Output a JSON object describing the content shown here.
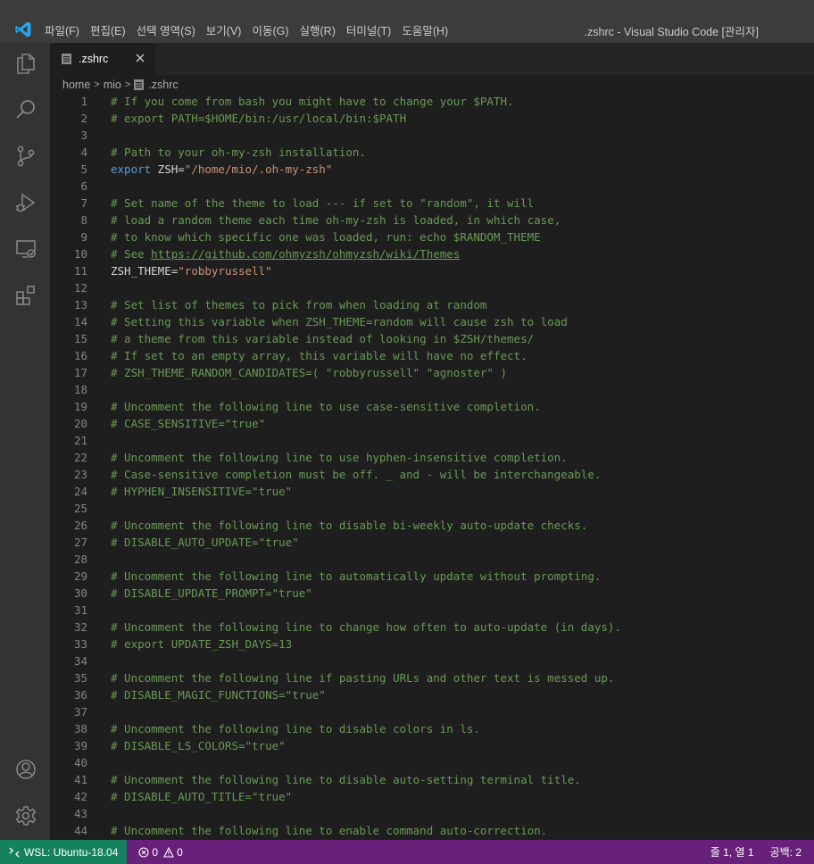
{
  "window": {
    "title": ".zshrc - Visual Studio Code [관리자]"
  },
  "menu": [
    {
      "label": "파일(F)"
    },
    {
      "label": "편집(E)"
    },
    {
      "label": "선택 영역(S)"
    },
    {
      "label": "보기(V)"
    },
    {
      "label": "이동(G)"
    },
    {
      "label": "실행(R)"
    },
    {
      "label": "터미널(T)"
    },
    {
      "label": "도움말(H)"
    }
  ],
  "activity_bar": {
    "icons": [
      "files-icon",
      "search-icon",
      "source-control-icon",
      "run-debug-icon",
      "remote-explorer-icon",
      "extensions-icon",
      "account-icon",
      "settings-gear-icon"
    ]
  },
  "tab": {
    "label": ".zshrc",
    "close_icon": "close-icon"
  },
  "breadcrumb": [
    "home",
    "mio",
    ".zshrc"
  ],
  "editor": {
    "lines": [
      {
        "n": "1",
        "parts": [
          {
            "t": "cm",
            "v": "# If you come from bash you might have to change your $PATH."
          }
        ]
      },
      {
        "n": "2",
        "parts": [
          {
            "t": "cm",
            "v": "# export PATH=$HOME/bin:/usr/local/bin:$PATH"
          }
        ]
      },
      {
        "n": "3",
        "parts": []
      },
      {
        "n": "4",
        "parts": [
          {
            "t": "cm",
            "v": "# Path to your oh-my-zsh installation."
          }
        ]
      },
      {
        "n": "5",
        "parts": [
          {
            "t": "kw",
            "v": "export"
          },
          {
            "t": "plain",
            "v": " ZSH="
          },
          {
            "t": "str",
            "v": "\"/home/mio/.oh-my-zsh\""
          }
        ]
      },
      {
        "n": "6",
        "parts": []
      },
      {
        "n": "7",
        "parts": [
          {
            "t": "cm",
            "v": "# Set name of the theme to load --- if set to \"random\", it will"
          }
        ]
      },
      {
        "n": "8",
        "parts": [
          {
            "t": "cm",
            "v": "# load a random theme each time oh-my-zsh is loaded, in which case,"
          }
        ]
      },
      {
        "n": "9",
        "parts": [
          {
            "t": "cm",
            "v": "# to know which specific one was loaded, run: echo $RANDOM_THEME"
          }
        ]
      },
      {
        "n": "10",
        "parts": [
          {
            "t": "cm",
            "v": "# See "
          },
          {
            "t": "cm link",
            "v": "https://github.com/ohmyzsh/ohmyzsh/wiki/Themes"
          }
        ]
      },
      {
        "n": "11",
        "parts": [
          {
            "t": "plain",
            "v": "ZSH_THEME="
          },
          {
            "t": "str",
            "v": "\"robbyrussell\""
          }
        ]
      },
      {
        "n": "12",
        "parts": []
      },
      {
        "n": "13",
        "parts": [
          {
            "t": "cm",
            "v": "# Set list of themes to pick from when loading at random"
          }
        ]
      },
      {
        "n": "14",
        "parts": [
          {
            "t": "cm",
            "v": "# Setting this variable when ZSH_THEME=random will cause zsh to load"
          }
        ]
      },
      {
        "n": "15",
        "parts": [
          {
            "t": "cm",
            "v": "# a theme from this variable instead of looking in $ZSH/themes/"
          }
        ]
      },
      {
        "n": "16",
        "parts": [
          {
            "t": "cm",
            "v": "# If set to an empty array, this variable will have no effect."
          }
        ]
      },
      {
        "n": "17",
        "parts": [
          {
            "t": "cm",
            "v": "# ZSH_THEME_RANDOM_CANDIDATES=( \"robbyrussell\" \"agnoster\" )"
          }
        ]
      },
      {
        "n": "18",
        "parts": []
      },
      {
        "n": "19",
        "parts": [
          {
            "t": "cm",
            "v": "# Uncomment the following line to use case-sensitive completion."
          }
        ]
      },
      {
        "n": "20",
        "parts": [
          {
            "t": "cm",
            "v": "# CASE_SENSITIVE=\"true\""
          }
        ]
      },
      {
        "n": "21",
        "parts": []
      },
      {
        "n": "22",
        "parts": [
          {
            "t": "cm",
            "v": "# Uncomment the following line to use hyphen-insensitive completion."
          }
        ]
      },
      {
        "n": "23",
        "parts": [
          {
            "t": "cm",
            "v": "# Case-sensitive completion must be off. _ and - will be interchangeable."
          }
        ]
      },
      {
        "n": "24",
        "parts": [
          {
            "t": "cm",
            "v": "# HYPHEN_INSENSITIVE=\"true\""
          }
        ]
      },
      {
        "n": "25",
        "parts": []
      },
      {
        "n": "26",
        "parts": [
          {
            "t": "cm",
            "v": "# Uncomment the following line to disable bi-weekly auto-update checks."
          }
        ]
      },
      {
        "n": "27",
        "parts": [
          {
            "t": "cm",
            "v": "# DISABLE_AUTO_UPDATE=\"true\""
          }
        ]
      },
      {
        "n": "28",
        "parts": []
      },
      {
        "n": "29",
        "parts": [
          {
            "t": "cm",
            "v": "# Uncomment the following line to automatically update without prompting."
          }
        ]
      },
      {
        "n": "30",
        "parts": [
          {
            "t": "cm",
            "v": "# DISABLE_UPDATE_PROMPT=\"true\""
          }
        ]
      },
      {
        "n": "31",
        "parts": []
      },
      {
        "n": "32",
        "parts": [
          {
            "t": "cm",
            "v": "# Uncomment the following line to change how often to auto-update (in days)."
          }
        ]
      },
      {
        "n": "33",
        "parts": [
          {
            "t": "cm",
            "v": "# export UPDATE_ZSH_DAYS=13"
          }
        ]
      },
      {
        "n": "34",
        "parts": []
      },
      {
        "n": "35",
        "parts": [
          {
            "t": "cm",
            "v": "# Uncomment the following line if pasting URLs and other text is messed up."
          }
        ]
      },
      {
        "n": "36",
        "parts": [
          {
            "t": "cm",
            "v": "# DISABLE_MAGIC_FUNCTIONS=\"true\""
          }
        ]
      },
      {
        "n": "37",
        "parts": []
      },
      {
        "n": "38",
        "parts": [
          {
            "t": "cm",
            "v": "# Uncomment the following line to disable colors in ls."
          }
        ]
      },
      {
        "n": "39",
        "parts": [
          {
            "t": "cm",
            "v": "# DISABLE_LS_COLORS=\"true\""
          }
        ]
      },
      {
        "n": "40",
        "parts": []
      },
      {
        "n": "41",
        "parts": [
          {
            "t": "cm",
            "v": "# Uncomment the following line to disable auto-setting terminal title."
          }
        ]
      },
      {
        "n": "42",
        "parts": [
          {
            "t": "cm",
            "v": "# DISABLE_AUTO_TITLE=\"true\""
          }
        ]
      },
      {
        "n": "43",
        "parts": []
      },
      {
        "n": "44",
        "parts": [
          {
            "t": "cm",
            "v": "# Uncomment the following line to enable command auto-correction."
          }
        ]
      }
    ]
  },
  "status_bar": {
    "remote": "WSL: Ubuntu-18.04",
    "errors": "0",
    "warnings": "0",
    "cursor": "줄 1, 열 1",
    "indent": "공백: 2"
  },
  "colors": {
    "comment": "#6a9955",
    "keyword": "#569cd6",
    "string": "#ce9178",
    "status_bar": "#68217a",
    "remote_badge": "#16825d",
    "logo": "#23a9f2"
  }
}
